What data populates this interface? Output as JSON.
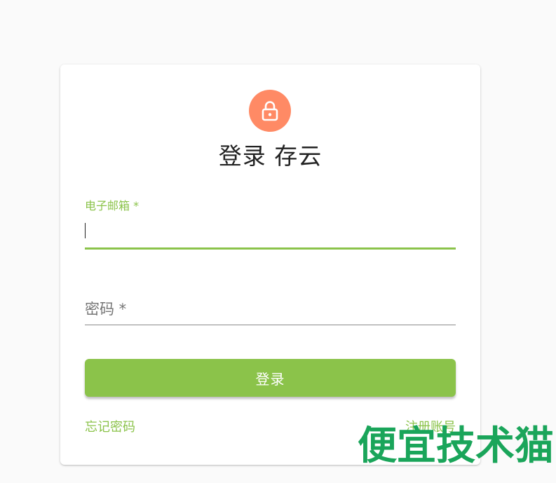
{
  "colors": {
    "accent": "#8bc34a",
    "avatar": "#ff8a65",
    "watermark": "#1aa55a"
  },
  "avatar": {
    "icon": "lock-open-icon"
  },
  "title": "登录 存云",
  "email_field": {
    "label": "电子邮箱 *",
    "value": ""
  },
  "password_field": {
    "label": "密码 *"
  },
  "login_button": {
    "label": "登录"
  },
  "links": {
    "forgot_password": "忘记密码",
    "register": "注册账号"
  },
  "watermark": {
    "text": "便宜技术猫"
  }
}
